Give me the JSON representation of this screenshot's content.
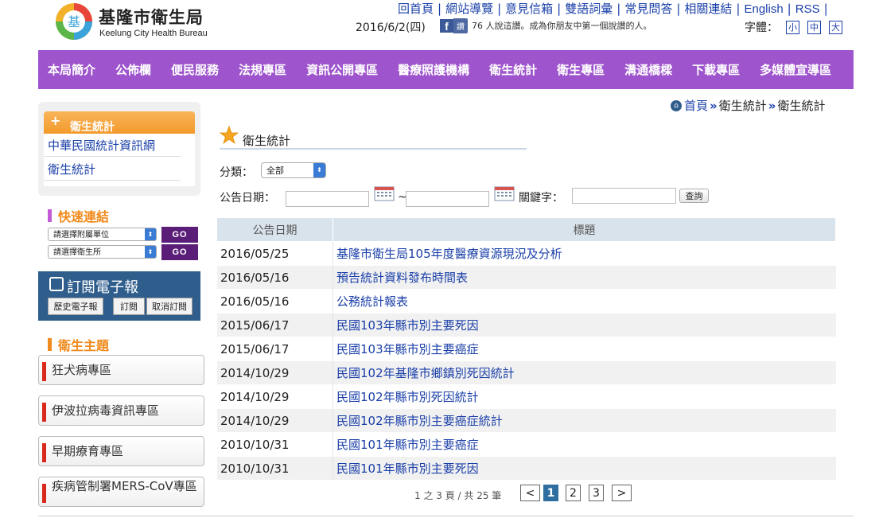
{
  "header": {
    "logo_text_zh": "基隆市衛生局",
    "logo_text_en": "Keelung City Health Bureau",
    "top_links": [
      "回首頁",
      "網站導覽",
      "意見信箱",
      "雙語詞彙",
      "常見問答",
      "相關連結",
      "English",
      "RSS"
    ],
    "date": "2016/6/2(四)",
    "fb_button": "讚",
    "fb_text": "76 人說這讚。成為你朋友中第一個說讚的人。",
    "font_size_label": "字體：",
    "font_sizes": [
      "小",
      "中",
      "大"
    ]
  },
  "nav": [
    "本局簡介",
    "公佈欄",
    "便民服務",
    "法規專區",
    "資訊公開專區",
    "醫療照護機構",
    "衛生統計",
    "衛生專區",
    "溝通橋樑",
    "下載專區",
    "多媒體宣導區"
  ],
  "sidebar": {
    "section_title": "衛生統計",
    "links": [
      "中華民國統計資訊網",
      "衛生統計"
    ],
    "quick_links_title": "快速連結",
    "select1": "請選擇附屬單位",
    "select2": "請選擇衛生所",
    "go_label": "GO",
    "epaper_title": "訂閱電子報",
    "epaper_buttons": [
      "歷史電子報",
      "訂閱",
      "取消訂閱"
    ],
    "topics_title": "衛生主題",
    "topics": [
      "狂犬病專區",
      "伊波拉病毒資訊專區",
      "早期療育專區",
      "疾病管制署MERS-CoV專區"
    ]
  },
  "breadcrumb": {
    "home": "首頁",
    "level1": "衛生統計",
    "level2": "衛生統計"
  },
  "page_title": "衛生統計",
  "filters": {
    "category_label": "分類：",
    "category_value": "全部",
    "date_label": "公告日期：",
    "range_sep": "~",
    "keyword_label": "關鍵字：",
    "search_button": "查詢"
  },
  "table": {
    "headers": [
      "公告日期",
      "標題"
    ],
    "rows": [
      {
        "date": "2016/05/25",
        "title": "基隆市衛生局105年度醫療資源現況及分析"
      },
      {
        "date": "2016/05/16",
        "title": "預告統計資料發布時間表"
      },
      {
        "date": "2016/05/16",
        "title": "公務統計報表"
      },
      {
        "date": "2015/06/17",
        "title": "民國103年縣市別主要死因"
      },
      {
        "date": "2015/06/17",
        "title": "民國103年縣市別主要癌症"
      },
      {
        "date": "2014/10/29",
        "title": "民國102年基隆市鄉鎮別死因統計"
      },
      {
        "date": "2014/10/29",
        "title": "民國102年縣市別死因統計"
      },
      {
        "date": "2014/10/29",
        "title": "民國102年縣市別主要癌症統計"
      },
      {
        "date": "2010/10/31",
        "title": "民國101年縣市別主要癌症"
      },
      {
        "date": "2010/10/31",
        "title": "民國101年縣市別主要死因"
      }
    ]
  },
  "pagination": {
    "info": "1 之 3 頁 / 共 25 筆",
    "prev": "<",
    "pages": [
      "1",
      "2",
      "3"
    ],
    "next": ">",
    "current": "1"
  },
  "colors": {
    "nav_bg": "#9e54cc",
    "link": "#1a3fa8",
    "accent_orange": "#f08a1c",
    "go_bg": "#5a1e78",
    "epaper_bg": "#2f5d8c"
  }
}
